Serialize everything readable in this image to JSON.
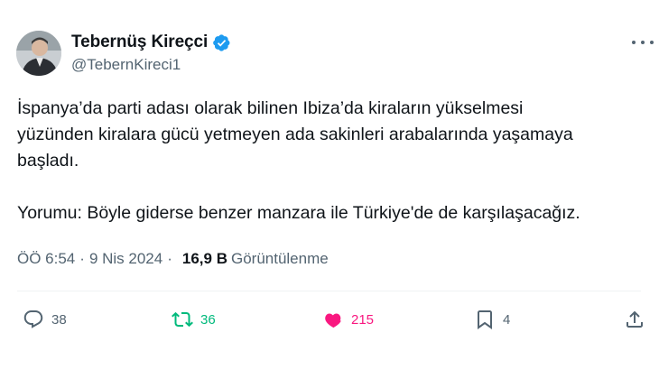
{
  "author": {
    "display_name": "Tebernüş Kireçci",
    "handle": "@TebernKireci1",
    "verified": true,
    "avatar_icon": "person-photo-avatar"
  },
  "body": {
    "line1": "İspanya’da parti adası olarak bilinen Ibiza’da kiraların yükselmesi",
    "line2": "yüzünden kiralara gücü yetmeyen ada sakinleri arabalarında yaşamaya",
    "line3": "başladı.",
    "line4": "Yorumu: Böyle giderse benzer manzara ile Türkiye'de de karşılaşacağız."
  },
  "meta": {
    "time": "ÖÖ 6:54",
    "separator": "·",
    "date": "9 Nis 2024",
    "views_count": "16,9 B",
    "views_label": "Görüntülenme"
  },
  "actions": {
    "reply_count": "38",
    "retweet_count": "36",
    "like_count": "215",
    "bookmark_count": "4"
  },
  "colors": {
    "verified_blue": "#1d9bf0",
    "retweet_green": "#00ba7c",
    "like_pink": "#f91880",
    "secondary_text": "#536471"
  }
}
